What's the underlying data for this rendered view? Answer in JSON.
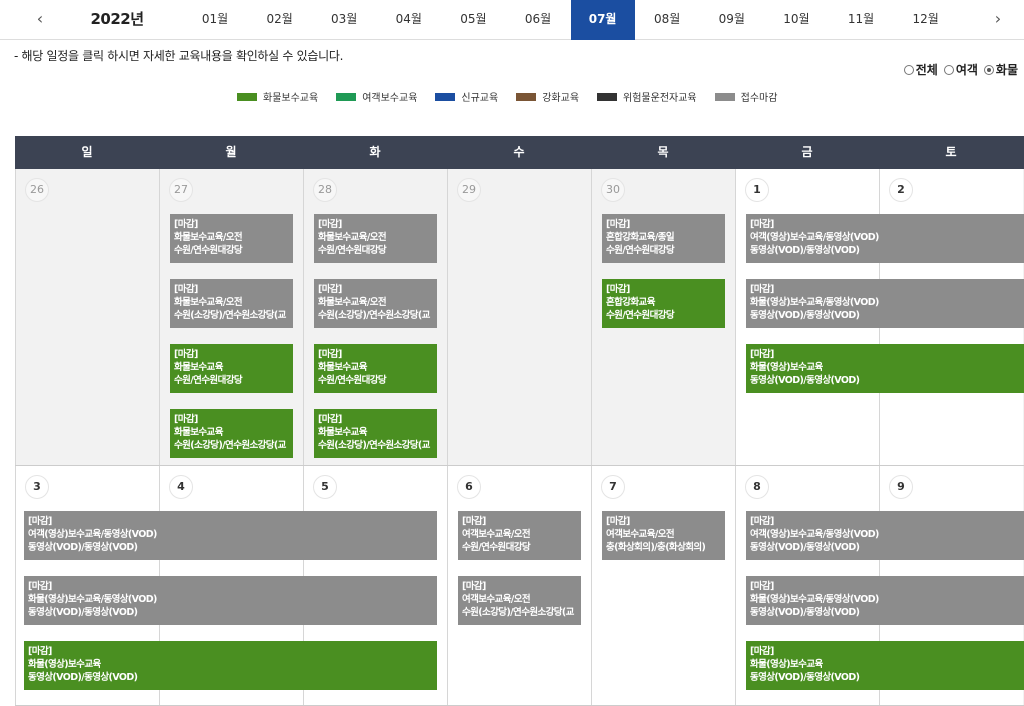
{
  "month_bar": {
    "prev_arrow": "‹",
    "next_arrow": "›",
    "year": "2022년",
    "months": [
      "01월",
      "02월",
      "03월",
      "04월",
      "05월",
      "06월",
      "07월",
      "08월",
      "09월",
      "10월",
      "11월",
      "12월"
    ],
    "active_month_index": 6
  },
  "notice": "- 해당 일정을 클릭 하시면 자세한 교육내용을 확인하실 수 있습니다.",
  "filter": {
    "options": [
      "전체",
      "여객",
      "화물"
    ],
    "selected_index": 2
  },
  "legend": [
    {
      "label": "화물보수교육",
      "color": "#4a8f21"
    },
    {
      "label": "여객보수교육",
      "color": "#1f9a55"
    },
    {
      "label": "신규교육",
      "color": "#1b4ea1"
    },
    {
      "label": "강화교육",
      "color": "#7a5535"
    },
    {
      "label": "위험물운전자교육",
      "color": "#333333"
    },
    {
      "label": "접수마감",
      "color": "#8c8c8c"
    }
  ],
  "weekdays": [
    "일",
    "월",
    "화",
    "수",
    "목",
    "금",
    "토"
  ],
  "weeks": [
    {
      "days": [
        "26",
        "27",
        "28",
        "29",
        "30",
        "1",
        "2"
      ],
      "events": [
        {
          "start": 1,
          "span": 1,
          "row": 0,
          "type": "closed",
          "lines": [
            "[마감]",
            "화물보수교육/오전",
            "수원/연수원대강당"
          ]
        },
        {
          "start": 1,
          "span": 1,
          "row": 1,
          "type": "closed",
          "lines": [
            "[마감]",
            "화물보수교육/오전",
            "수원(소강당)/연수원소강당(교"
          ]
        },
        {
          "start": 1,
          "span": 1,
          "row": 2,
          "type": "green",
          "lines": [
            "[마감]",
            "화물보수교육",
            "수원/연수원대강당"
          ]
        },
        {
          "start": 1,
          "span": 1,
          "row": 3,
          "type": "green",
          "lines": [
            "[마감]",
            "화물보수교육",
            "수원(소강당)/연수원소강당(교"
          ]
        },
        {
          "start": 2,
          "span": 1,
          "row": 0,
          "type": "closed",
          "lines": [
            "[마감]",
            "화물보수교육/오전",
            "수원/연수원대강당"
          ]
        },
        {
          "start": 2,
          "span": 1,
          "row": 1,
          "type": "closed",
          "lines": [
            "[마감]",
            "화물보수교육/오전",
            "수원(소강당)/연수원소강당(교"
          ]
        },
        {
          "start": 2,
          "span": 1,
          "row": 2,
          "type": "green",
          "lines": [
            "[마감]",
            "화물보수교육",
            "수원/연수원대강당"
          ]
        },
        {
          "start": 2,
          "span": 1,
          "row": 3,
          "type": "green",
          "lines": [
            "[마감]",
            "화물보수교육",
            "수원(소강당)/연수원소강당(교"
          ]
        },
        {
          "start": 4,
          "span": 1,
          "row": 0,
          "type": "closed",
          "lines": [
            "[마감]",
            "혼합강화교육/종일",
            "수원/연수원대강당"
          ]
        },
        {
          "start": 4,
          "span": 1,
          "row": 1,
          "type": "green",
          "lines": [
            "[마감]",
            "혼합강화교육",
            "수원/연수원대강당"
          ]
        },
        {
          "start": 5,
          "span": 2,
          "row": 0,
          "type": "closed",
          "lines": [
            "[마감]",
            "여객(영상)보수교육/동영상(VOD)",
            "동영상(VOD)/동영상(VOD)"
          ]
        },
        {
          "start": 5,
          "span": 2,
          "row": 1,
          "type": "closed",
          "lines": [
            "[마감]",
            "화물(영상)보수교육/동영상(VOD)",
            "동영상(VOD)/동영상(VOD)"
          ]
        },
        {
          "start": 5,
          "span": 2,
          "row": 2,
          "type": "green",
          "lines": [
            "[마감]",
            "화물(영상)보수교육",
            "동영상(VOD)/동영상(VOD)"
          ]
        }
      ]
    },
    {
      "days": [
        "3",
        "4",
        "5",
        "6",
        "7",
        "8",
        "9"
      ],
      "events": [
        {
          "start": 0,
          "span": 3,
          "row": 0,
          "type": "closed",
          "lines": [
            "[마감]",
            "여객(영상)보수교육/동영상(VOD)",
            "동영상(VOD)/동영상(VOD)"
          ]
        },
        {
          "start": 0,
          "span": 3,
          "row": 1,
          "type": "closed",
          "lines": [
            "[마감]",
            "화물(영상)보수교육/동영상(VOD)",
            "동영상(VOD)/동영상(VOD)"
          ]
        },
        {
          "start": 0,
          "span": 3,
          "row": 2,
          "type": "green",
          "lines": [
            "[마감]",
            "화물(영상)보수교육",
            "동영상(VOD)/동영상(VOD)"
          ]
        },
        {
          "start": 3,
          "span": 1,
          "row": 0,
          "type": "closed",
          "lines": [
            "[마감]",
            "여객보수교육/오전",
            "수원/연수원대강당"
          ]
        },
        {
          "start": 3,
          "span": 1,
          "row": 1,
          "type": "closed",
          "lines": [
            "[마감]",
            "여객보수교육/오전",
            "수원(소강당)/연수원소강당(교"
          ]
        },
        {
          "start": 4,
          "span": 1,
          "row": 0,
          "type": "closed",
          "lines": [
            "[마감]",
            "여객보수교육/오전",
            "충(화상회의)/충(화상회의)"
          ]
        },
        {
          "start": 5,
          "span": 2,
          "row": 0,
          "type": "closed",
          "lines": [
            "[마감]",
            "여객(영상)보수교육/동영상(VOD)",
            "동영상(VOD)/동영상(VOD)"
          ]
        },
        {
          "start": 5,
          "span": 2,
          "row": 1,
          "type": "closed",
          "lines": [
            "[마감]",
            "화물(영상)보수교육/동영상(VOD)",
            "동영상(VOD)/동영상(VOD)"
          ]
        },
        {
          "start": 5,
          "span": 2,
          "row": 2,
          "type": "green",
          "lines": [
            "[마감]",
            "화물(영상)보수교육",
            "동영상(VOD)/동영상(VOD)"
          ]
        }
      ]
    }
  ]
}
